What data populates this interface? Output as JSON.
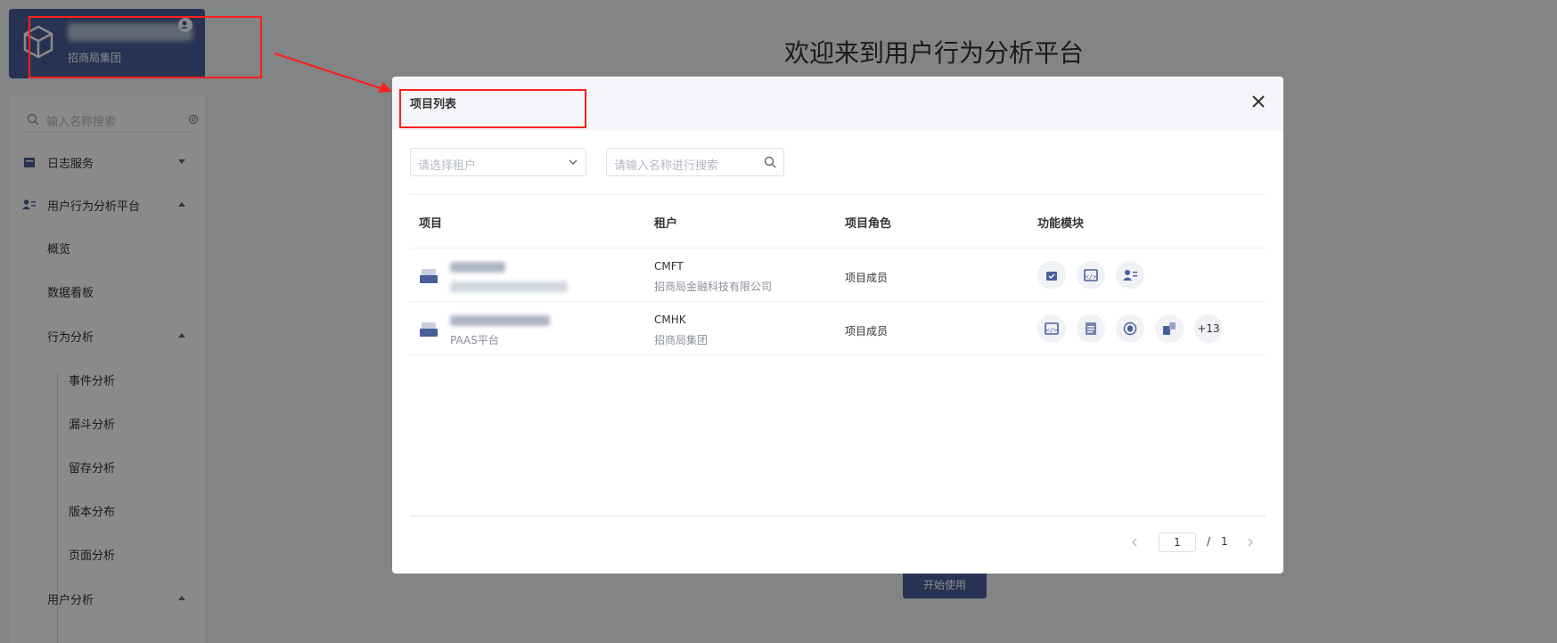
{
  "sidebar": {
    "project_sub": "招商局集团",
    "search_placeholder": "输入名称搜索",
    "items": [
      {
        "label": "日志服务"
      },
      {
        "label": "用户行为分析平台"
      },
      {
        "label": "概览"
      },
      {
        "label": "数据看板"
      },
      {
        "label": "行为分析"
      },
      {
        "label": "事件分析"
      },
      {
        "label": "漏斗分析"
      },
      {
        "label": "留存分析"
      },
      {
        "label": "版本分布"
      },
      {
        "label": "页面分析"
      },
      {
        "label": "用户分析"
      }
    ]
  },
  "main": {
    "welcome": "欢迎来到用户行为分析平台",
    "start_button": "开始使用"
  },
  "modal": {
    "title": "项目列表",
    "tenant_placeholder": "请选择租户",
    "search_placeholder": "请输入名称进行搜索",
    "columns": [
      "项目",
      "租户",
      "项目角色",
      "功能模块"
    ],
    "rows": [
      {
        "project_sub": "",
        "tenant": "CMFT",
        "tenant_full": "招商局金融科技有限公司",
        "role": "项目成员"
      },
      {
        "project_sub": "PAAS平台",
        "tenant": "CMHK",
        "tenant_full": "招商局集团",
        "role": "项目成员",
        "more": "+13"
      }
    ],
    "pagination": {
      "current": "1",
      "separator": "/",
      "total": "1"
    }
  }
}
